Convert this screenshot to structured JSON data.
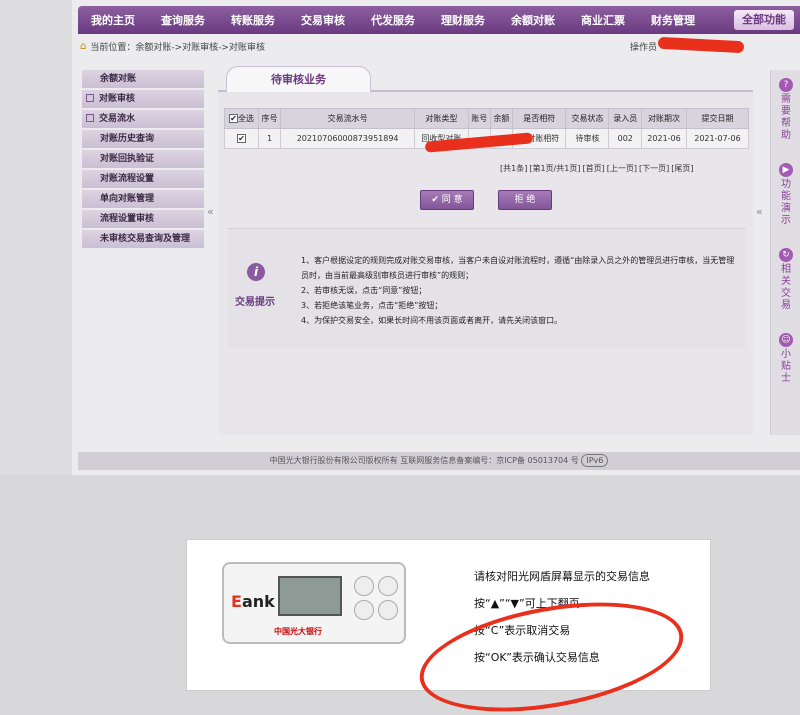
{
  "topnav": {
    "items": [
      "我的主页",
      "查询服务",
      "转账服务",
      "交易审核",
      "代发服务",
      "理财服务",
      "余额对账",
      "商业汇票",
      "财务管理"
    ],
    "all_functions": "全部功能"
  },
  "breadcrumb": {
    "label": "当前位置：余额对账->对账审核->对账审核",
    "operator_label": "操作员"
  },
  "sidebar": {
    "items": [
      {
        "label": "余额对账",
        "box": false
      },
      {
        "label": "对账审核",
        "box": true
      },
      {
        "label": "交易流水",
        "box": true
      },
      {
        "label": "对账历史查询",
        "box": false
      },
      {
        "label": "对账回执验证",
        "box": false
      },
      {
        "label": "对账流程设置",
        "box": false
      },
      {
        "label": "单向对账管理",
        "box": false
      },
      {
        "label": "流程设置审核",
        "box": false
      },
      {
        "label": "未审核交易查询及管理",
        "box": false
      }
    ]
  },
  "tab": {
    "label": "待审核业务"
  },
  "table": {
    "headers": [
      "全选",
      "序号",
      "交易流水号",
      "对账类型",
      "账号",
      "余额",
      "是否相符",
      "交易状态",
      "录入员",
      "对账期次",
      "提交日期"
    ],
    "rows": [
      [
        "",
        "1",
        "20210706000873951894",
        "回收型对账",
        "",
        "",
        "账对账相符",
        "待审核",
        "002",
        "2021-06",
        "2021-07-06"
      ]
    ]
  },
  "pager": {
    "items": [
      "[共1条]",
      "[第1页/共1页]",
      "[首页]",
      "[上一页]",
      "[下一页]",
      "[尾页]"
    ]
  },
  "buttons": {
    "agree": "同 意",
    "reject": "拒 绝"
  },
  "tips": {
    "label": "交易提示",
    "icon": "i",
    "lines": [
      "1、客户根据设定的规则完成对账交易审核，当客户未自设对账流程时，遵循“由除录入员之外的管理员进行审核，当无管理员时，由当前最高级别审核员进行审核”的规则；",
      "2、若审核无误，点击“同意”按钮；",
      "3、若拒绝该笔业务，点击“拒绝”按钮；",
      "4、为保护交易安全，如果长时间不用该页面或者离开，请先关闭该窗口。"
    ]
  },
  "right_rail": {
    "items": [
      {
        "icon": "?",
        "label": "需要帮助"
      },
      {
        "icon": "▶",
        "label": "功能演示"
      },
      {
        "icon": "↻",
        "label": "相关交易"
      },
      {
        "icon": "☺",
        "label": "小贴士"
      }
    ]
  },
  "footer": {
    "text": "中国光大银行股份有限公司版权所有 互联网服务信息备案编号：京ICP备 05013704 号",
    "ipv6": "IPv6"
  },
  "popup": {
    "token_brand_e": "E",
    "token_brand_rest": "ank",
    "token_bank": "中国光大银行",
    "lines": [
      "请核对阳光网盾屏幕显示的交易信息",
      "按“▲”“▼”可上下翻页",
      "按“C”表示取消交易",
      "按“OK”表示确认交易信息"
    ]
  },
  "colors": {
    "brand_purple": "#6a3a80",
    "redaction_red": "#e8301c"
  }
}
